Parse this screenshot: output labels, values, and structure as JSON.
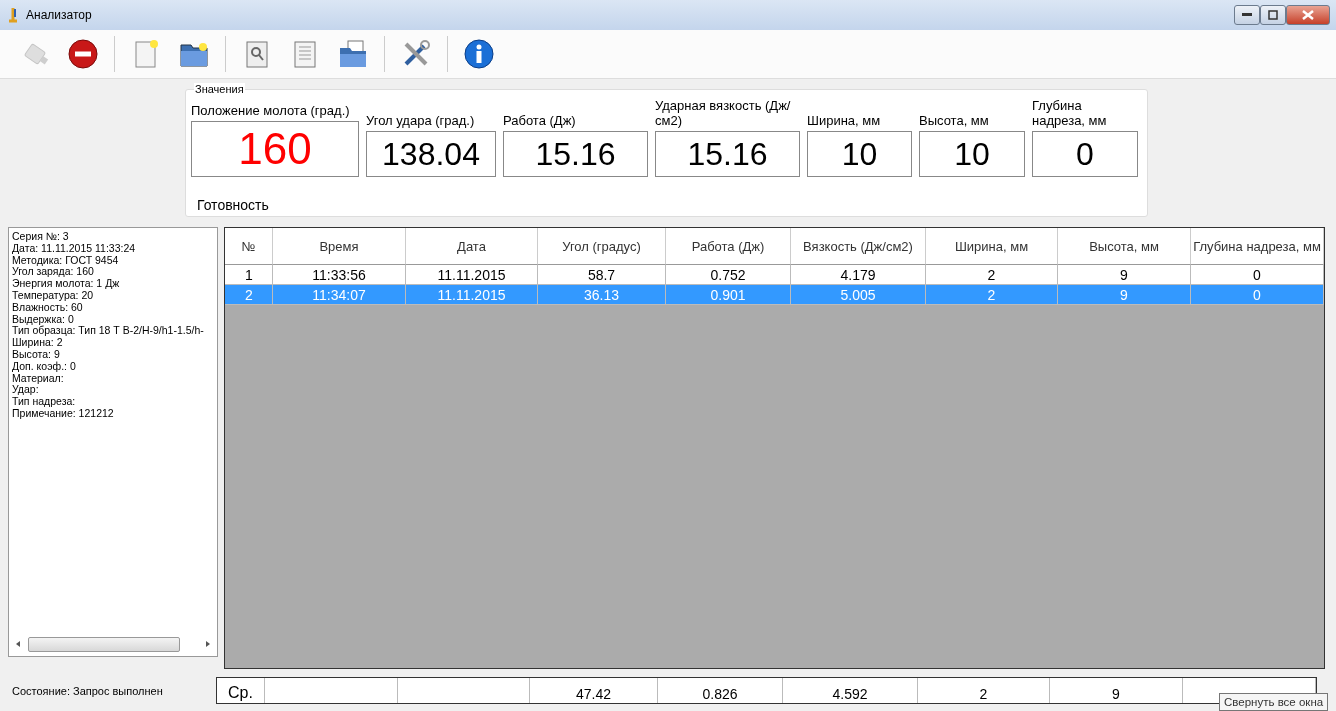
{
  "window": {
    "title": "Анализатор"
  },
  "toolbar": [
    {
      "kind": "plug",
      "disabled": true
    },
    {
      "kind": "stop",
      "disabled": false
    },
    {
      "kind": "separator"
    },
    {
      "kind": "new",
      "disabled": false
    },
    {
      "kind": "open",
      "disabled": false
    },
    {
      "kind": "separator"
    },
    {
      "kind": "preview",
      "disabled": false
    },
    {
      "kind": "report",
      "disabled": false
    },
    {
      "kind": "export",
      "disabled": false
    },
    {
      "kind": "separator"
    },
    {
      "kind": "tools",
      "disabled": false
    },
    {
      "kind": "separator"
    },
    {
      "kind": "info",
      "disabled": false
    }
  ],
  "values": {
    "title": "Значения",
    "status": "Готовность",
    "fields": [
      {
        "label": "Положение молота (град.)",
        "value": "160",
        "alert": true
      },
      {
        "label": "Угол удара (град.)",
        "value": "138.04",
        "alert": false
      },
      {
        "label": "Работа (Дж)",
        "value": "15.16",
        "alert": false
      },
      {
        "label": "Ударная вязкость (Дж/см2)",
        "value": "15.16",
        "alert": false
      },
      {
        "label": "Ширина, мм",
        "value": "10",
        "alert": false
      },
      {
        "label": "Высота, мм",
        "value": "10",
        "alert": false
      },
      {
        "label": "Глубина надреза, мм",
        "value": "0",
        "alert": false
      }
    ]
  },
  "series_info": [
    "Серия №: 3",
    "Дата: 11.11.2015 11:33:24",
    "Методика: ГОСТ 9454",
    "Угол заряда: 160",
    "Энергия молота: 1 Дж",
    "Температура: 20",
    "Влажность: 60",
    "Выдержка: 0",
    "Тип образца: Тип 18 Т В-2/Н-9/h1-1.5/h-",
    "Ширина: 2",
    "Высота: 9",
    "Доп. коэф.: 0",
    "Материал:",
    "Удар:",
    "Тип надреза:",
    "Примечание: 121212"
  ],
  "table": {
    "columns": [
      "№",
      "Время",
      "Дата",
      "Угол (градус)",
      "Работа (Дж)",
      "Вязкость (Дж/см2)",
      "Ширина, мм",
      "Высота, мм",
      "Глубина надреза, мм"
    ],
    "rows": [
      {
        "cells": [
          "1",
          "11:33:56",
          "11.11.2015",
          "58.7",
          "0.752",
          "4.179",
          "2",
          "9",
          "0"
        ],
        "selected": false
      },
      {
        "cells": [
          "2",
          "11:34:07",
          "11.11.2015",
          "36.13",
          "0.901",
          "5.005",
          "2",
          "9",
          "0"
        ],
        "selected": true
      }
    ],
    "footer": {
      "label": "Ср.",
      "values": [
        "47.42",
        "0.826",
        "4.592",
        "2",
        "9"
      ]
    }
  },
  "status_bar": "Состояние: Запрос выполнен",
  "tooltip": "Свернуть все окна"
}
